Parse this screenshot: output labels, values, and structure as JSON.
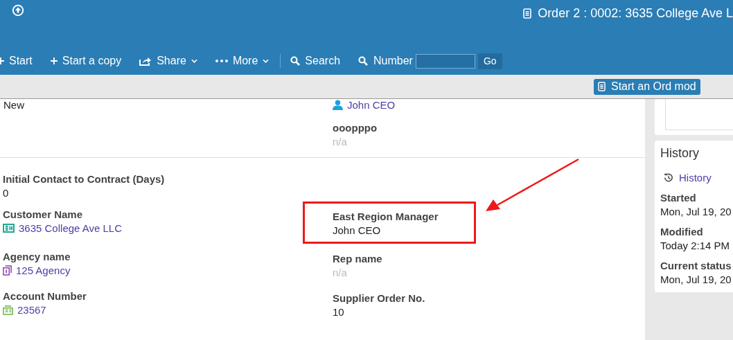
{
  "header": {
    "title": "Order 2 : 0002: 3635 College Ave L"
  },
  "toolbar": {
    "items": [
      {
        "label": "Start",
        "kind": "add"
      },
      {
        "label": "Start a copy",
        "kind": "add"
      },
      {
        "label": "Share",
        "kind": "share"
      },
      {
        "label": "More",
        "kind": "more"
      },
      {
        "label": "Search",
        "kind": "search"
      }
    ],
    "number_search": {
      "label": "Number",
      "button": "Go"
    }
  },
  "subbar": {
    "button": "Start an Ord mod"
  },
  "top_section": {
    "left": [
      {
        "value": "New"
      }
    ],
    "right": [
      {
        "value": "John CEO",
        "kind": "person-link"
      },
      {
        "label": "ooopppo",
        "value": "n/a",
        "kind": "text",
        "empty": true
      }
    ]
  },
  "rows": [
    {
      "left": {
        "label": "Initial Contact to Contract (Days)",
        "value": "0",
        "kind": "text",
        "empty": false,
        "highlighted": false
      },
      "right": null
    },
    {
      "left": {
        "label": "Customer Name",
        "value": "3635 College Ave LLC",
        "kind": "customer-link",
        "empty": false,
        "highlighted": false
      },
      "right": {
        "label": "East Region Manager",
        "value": "John CEO",
        "kind": "text",
        "empty": false,
        "highlighted": true
      }
    },
    {
      "left": {
        "label": "Agency name",
        "value": "125 Agency",
        "kind": "agency-link",
        "empty": false,
        "highlighted": false
      },
      "right": {
        "label": "Rep name",
        "value": "n/a",
        "kind": "text",
        "empty": true,
        "highlighted": false
      }
    },
    {
      "left": {
        "label": "Account Number",
        "value": "23567",
        "kind": "account-link",
        "empty": false,
        "highlighted": false
      },
      "right": {
        "label": "Supplier Order No.",
        "value": "10",
        "kind": "text",
        "empty": false,
        "highlighted": false
      }
    }
  ],
  "history": {
    "title": "History",
    "link": "History",
    "items": [
      {
        "label": "Started",
        "value": "Mon, Jul 19, 20"
      },
      {
        "label": "Modified",
        "value": "Today 2:14 PM"
      },
      {
        "label": "Current status",
        "value": "Mon, Jul 19, 20"
      }
    ]
  }
}
